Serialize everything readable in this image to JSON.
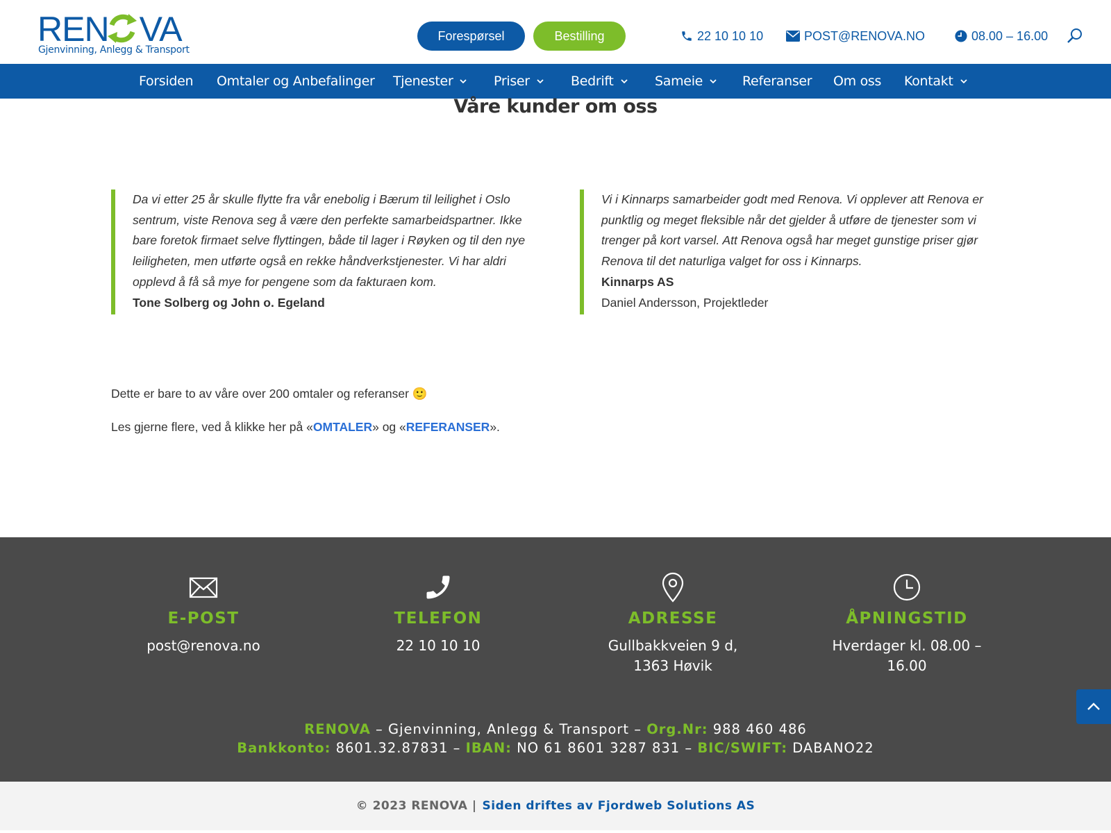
{
  "header": {
    "logo_left": "REN",
    "logo_right": "VA",
    "logo_tagline": "Gjenvinning, Anlegg & Transport",
    "btn_request": "Forespørsel",
    "btn_order": "Bestilling",
    "phone": "22 10 10 10",
    "email": "POST@RENOVA.NO",
    "hours": "08.00 – 16.00",
    "colors": {
      "brand_blue": "#0d5aa6",
      "brand_green": "#7dbd2a"
    }
  },
  "nav": {
    "items": [
      {
        "label": "Forsiden"
      },
      {
        "label": "Omtaler og Anbefalinger"
      },
      {
        "label": "Tjenester"
      },
      {
        "label": "Priser"
      },
      {
        "label": "Bedrift"
      },
      {
        "label": "Sameie"
      },
      {
        "label": "Referanser"
      },
      {
        "label": "Om oss"
      },
      {
        "label": "Kontakt"
      }
    ]
  },
  "main": {
    "title": "Våre kunder om oss",
    "quotes": [
      {
        "text": "Da vi etter 25 år skulle flytte fra vår enebolig i Bærum til leilighet i Oslo sentrum, viste Renova seg å være den perfekte samarbeidspartner. Ikke bare foretok firmaet selve flyttingen, både til lager i Røyken og til den nye leiligheten, men utførte også en rekke håndverkstjenester. Vi har aldri opplevd å få så mye for pengene som da fakturaen kom.",
        "author": "Tone Solberg og John o. Egeland"
      },
      {
        "text": "Vi i Kinnarps samarbeider godt med Renova. Vi opplever att Renova er punktlig og meget fleksible når det gjelder å utføre de tjenester som vi trenger på kort varsel. Att Renova også har meget gunstige priser gjør Renova til det naturliga valget for oss i Kinnarps.",
        "author": "Kinnarps AS",
        "role": "Daniel Andersson, Projektleder"
      }
    ],
    "para1": "Dette er bare to av våre over 200 omtaler og referanser 🙂",
    "para2_pre": "Les gjerne flere, ved å klikke her på  «",
    "para2_link1": "OMTALER",
    "para2_mid": "» og «",
    "para2_link2": "REFERANSER",
    "para2_post": "»."
  },
  "footer": {
    "columns": [
      {
        "icon": "envelope-icon",
        "heading": "E-POST",
        "value": "post@renova.no"
      },
      {
        "icon": "phone-icon",
        "heading": "TELEFON",
        "value": "22 10 10 10"
      },
      {
        "icon": "location-pin-icon",
        "heading": "ADRESSE",
        "value_line1": "Gullbakkveien 9 d,",
        "value_line2": "1363 Høvik"
      },
      {
        "icon": "clock-icon",
        "heading": "ÅPNINGSTID",
        "value_line1": "Hverdager kl. 08.00 –",
        "value_line2": "16.00"
      }
    ],
    "line1": {
      "brand": "RENOVA",
      "desc": " – Gjenvinning, Anlegg & Transport – ",
      "org_label": "Org.Nr:",
      "org_value": " 988 460 486"
    },
    "line2": {
      "bank_label": "Bankkonto:",
      "bank_value": " 8601.32.87831 – ",
      "iban_label": "IBAN:",
      "iban_value": " NO 61 8601 3287 831 – ",
      "bic_label": "BIC/SWIFT:",
      "bic_value": " DABANO22"
    },
    "copyright": "© 2023 RENOVA |",
    "credit": "Siden driftes av Fjordweb Solutions AS"
  }
}
